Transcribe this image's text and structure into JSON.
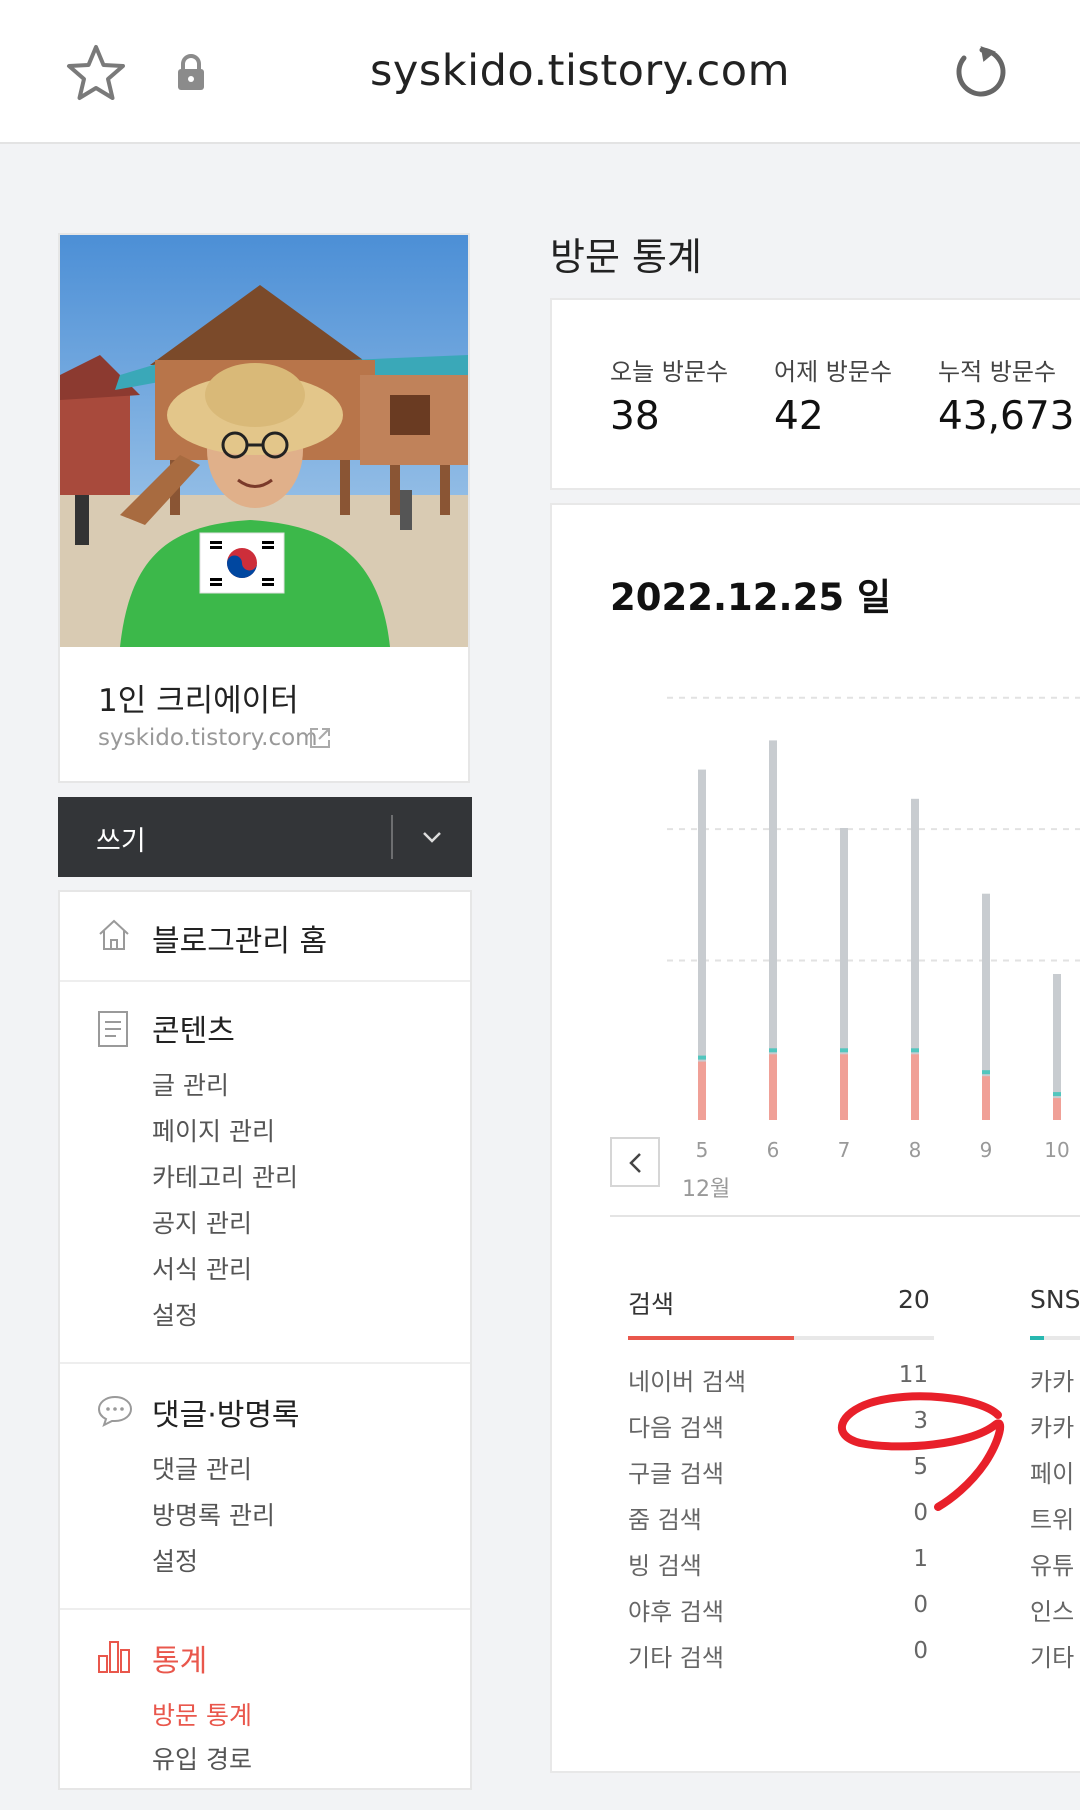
{
  "browser": {
    "url": "syskido.tistory.com",
    "icons": [
      "star-icon",
      "lock-icon",
      "reload-icon"
    ]
  },
  "profile": {
    "blog_name": "1인 크리에이터",
    "blog_url": "syskido.tistory.com"
  },
  "write": {
    "label": "쓰기"
  },
  "menu": {
    "home": {
      "label": "블로그관리 홈",
      "icon": "home-icon"
    },
    "content": {
      "label": "콘텐츠",
      "icon": "document-icon",
      "items": [
        "글 관리",
        "페이지 관리",
        "카테고리 관리",
        "공지 관리",
        "서식 관리",
        "설정"
      ]
    },
    "comments": {
      "label": "댓글·방명록",
      "icon": "speech-bubble-icon",
      "items": [
        "댓글 관리",
        "방명록 관리",
        "설정"
      ]
    },
    "stats": {
      "label": "통계",
      "icon": "bar-chart-icon",
      "items": [
        "방문 통계",
        "유입 경로"
      ]
    }
  },
  "stats": {
    "title": "방문 통계",
    "today_label": "오늘 방문수",
    "today_value": "38",
    "yesterday_label": "어제 방문수",
    "yesterday_value": "42",
    "total_label": "누적 방문수",
    "total_value": "43,673"
  },
  "chart": {
    "date_label": "2022.12.25 일",
    "month_label": "12월"
  },
  "chart_data": {
    "type": "bar",
    "categories": [
      "5",
      "6",
      "7",
      "8",
      "9",
      "10"
    ],
    "series": [
      {
        "values": [
          48,
          52,
          40,
          44,
          31,
          20
        ]
      },
      {
        "values": [
          8,
          9,
          9,
          9,
          6,
          3
        ]
      }
    ],
    "xlabel": "12월",
    "colors": {
      "total": "#c8ccd0",
      "search": "#f0a097",
      "sns": "#52c6be"
    },
    "ylim": [
      0,
      60
    ],
    "grid": true
  },
  "inflow": {
    "search_tab": {
      "label": "검색",
      "count": "20"
    },
    "sns_tab": {
      "label": "SNS"
    },
    "search_rows": [
      {
        "label": "네이버 검색",
        "value": "11"
      },
      {
        "label": "다음 검색",
        "value": "3"
      },
      {
        "label": "구글 검색",
        "value": "5"
      },
      {
        "label": "줌 검색",
        "value": "0"
      },
      {
        "label": "빙 검색",
        "value": "1"
      },
      {
        "label": "야후 검색",
        "value": "0"
      },
      {
        "label": "기타 검색",
        "value": "0"
      }
    ],
    "sns_rows": [
      "카카",
      "카카",
      "페이",
      "트위",
      "유튜",
      "인스",
      "기타"
    ]
  },
  "colors": {
    "accent": "#e9574c",
    "dark_bar": "#333538"
  }
}
